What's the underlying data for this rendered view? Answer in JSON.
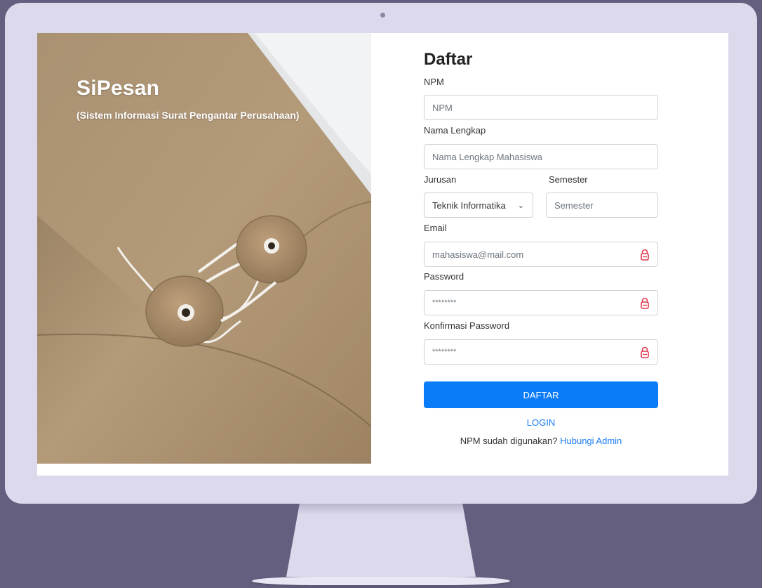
{
  "brand": {
    "title": "SiPesan",
    "subtitle": "(Sistem Informasi Surat Pengantar Perusahaan)"
  },
  "form": {
    "heading": "Daftar",
    "npm": {
      "label": "NPM",
      "placeholder": "NPM"
    },
    "nama": {
      "label": "Nama Lengkap",
      "placeholder": "Nama Lengkap Mahasiswa"
    },
    "jurusan": {
      "label": "Jurusan",
      "value": "Teknik Informatika"
    },
    "semester": {
      "label": "Semester",
      "placeholder": "Semester"
    },
    "email": {
      "label": "Email",
      "value": "mahasiswa@mail.com"
    },
    "password": {
      "label": "Password",
      "value": "********"
    },
    "konfirmasi": {
      "label": "Konfirmasi Password",
      "value": "********"
    },
    "submit_label": "DAFTAR",
    "login_link": "LOGIN",
    "hint_text": "NPM sudah digunakan?",
    "hint_link": "Hubungi Admin"
  },
  "icons": {
    "password_manager": "lock-icon"
  },
  "colors": {
    "primary": "#0b7cf8",
    "link": "#1a7cf2",
    "lock": "#e0394f",
    "background": "#655f7f",
    "monitor": "#dcd9ed"
  }
}
